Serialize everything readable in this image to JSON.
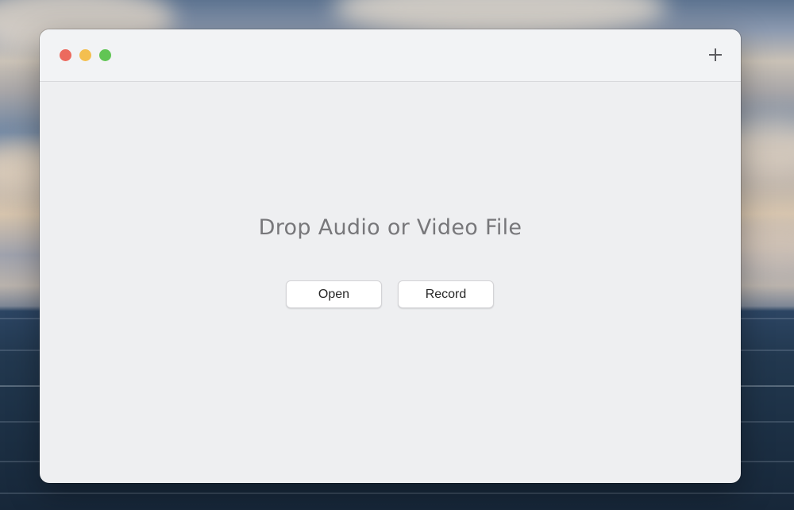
{
  "window": {
    "add_icon": "plus-icon"
  },
  "main": {
    "title": "Drop Audio or Video File",
    "open_label": "Open",
    "record_label": "Record"
  },
  "colors": {
    "close": "#ec6a5e",
    "minimize": "#f4bf4f",
    "zoom": "#61c554",
    "window_bg": "#eeeff1",
    "title_text": "#77777a"
  }
}
